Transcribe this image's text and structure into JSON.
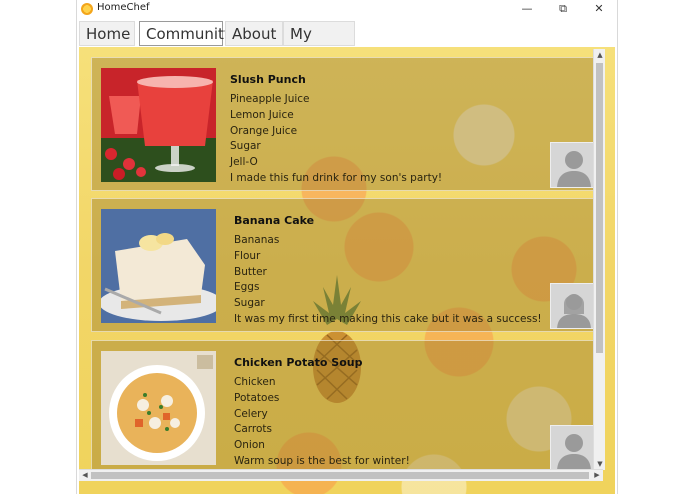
{
  "app": {
    "title": "HomeChef"
  },
  "window_controls": {
    "minimize": "—",
    "restore": "⧉",
    "close": "✕"
  },
  "nav": {
    "tabs": [
      {
        "label": "Home",
        "active": false
      },
      {
        "label": "Community",
        "active": true
      },
      {
        "label": "About",
        "active": false
      },
      {
        "label": "My Profile",
        "active": false
      }
    ]
  },
  "recipes": [
    {
      "title": "Slush Punch",
      "lines": [
        "Pineapple Juice",
        "Lemon Juice",
        "Orange Juice",
        "Sugar",
        "Jell-O",
        "I made this fun drink for my son's party!"
      ]
    },
    {
      "title": "Banana Cake",
      "lines": [
        "Bananas",
        "Flour",
        "Butter",
        "Eggs",
        "Sugar",
        "It was my first time making this cake but it was a success!"
      ]
    },
    {
      "title": "Chicken Potato Soup",
      "lines": [
        "Chicken",
        "Potatoes",
        "Celery",
        "Carrots",
        "Onion",
        "Warm soup is the best for winter!"
      ]
    }
  ],
  "scroll": {
    "up": "▲",
    "down": "▼",
    "left": "◀",
    "right": "▶"
  },
  "icons": {
    "app": "chef-hat-icon",
    "avatar": "user-silhouette-icon"
  },
  "colors": {
    "accent": "#f2d667"
  }
}
